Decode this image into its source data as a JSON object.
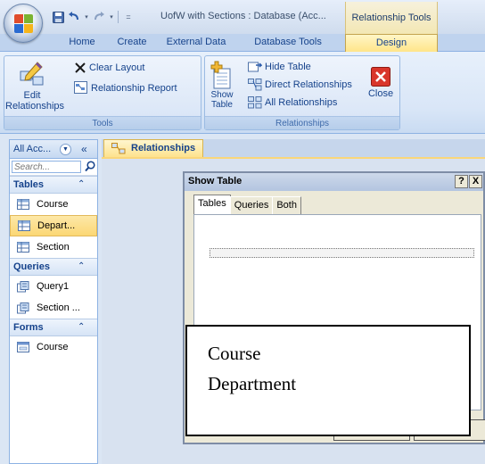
{
  "window": {
    "title": "UofW with Sections : Database (Acc...",
    "context_tab_header": "Relationship Tools"
  },
  "ribbon_tabs": [
    "Home",
    "Create",
    "External Data",
    "Database Tools",
    "Design"
  ],
  "active_tab": "Design",
  "ribbon": {
    "tools_group": {
      "label": "Tools",
      "edit_relationships": "Edit Relationships",
      "clear_layout": "Clear Layout",
      "relationship_report": "Relationship Report"
    },
    "relationships_group": {
      "label": "Relationships",
      "show_table": "Show Table",
      "hide_table": "Hide Table",
      "direct_relationships": "Direct Relationships",
      "all_relationships": "All Relationships",
      "close": "Close"
    }
  },
  "nav_pane": {
    "header": "All Acc...",
    "search_placeholder": "Search...",
    "sections": [
      {
        "title": "Tables",
        "items": [
          "Course",
          "Depart...",
          "Section"
        ]
      },
      {
        "title": "Queries",
        "items": [
          "Query1",
          "Section ..."
        ]
      },
      {
        "title": "Forms",
        "items": [
          "Course"
        ]
      }
    ],
    "selected_item": "Depart..."
  },
  "document_tab": "Relationships",
  "dialog": {
    "title": "Show Table",
    "help_button": "?",
    "close_button": "X",
    "tabs": [
      "Tables",
      "Queries",
      "Both"
    ],
    "active_tab": "Tables"
  },
  "overlay_text": [
    "Course",
    "Department"
  ],
  "colors": {
    "ribbon_blue": "#dbe6f4",
    "context_tab": "#ffe486",
    "accent_text": "#15428b",
    "close_red": "#d9362b"
  }
}
